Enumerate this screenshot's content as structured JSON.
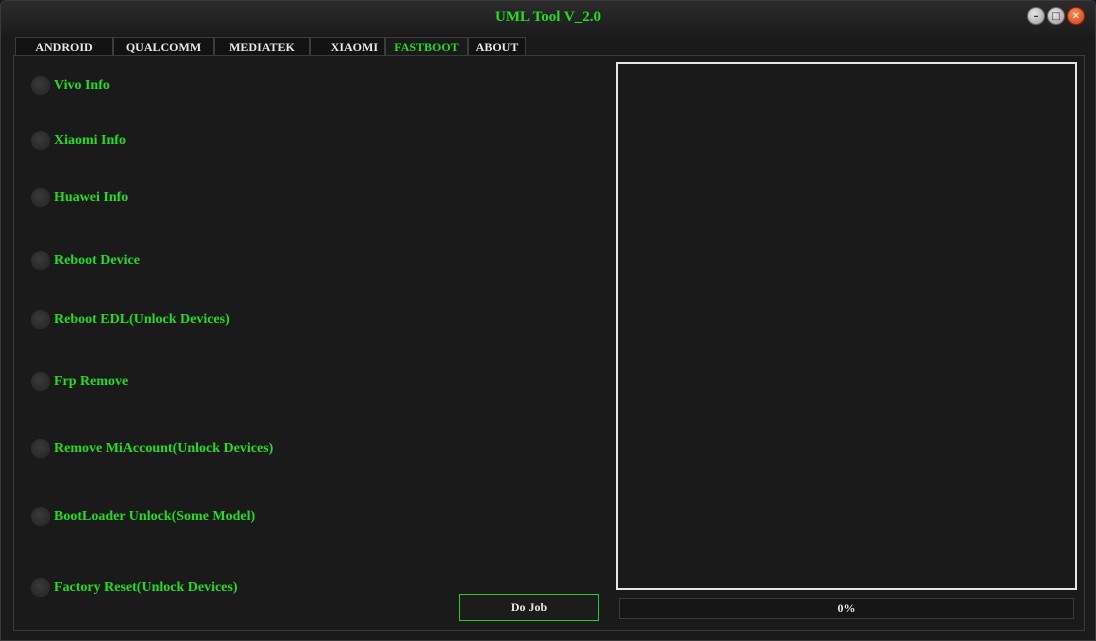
{
  "window": {
    "title": "UML Tool V_2.0"
  },
  "tabs": [
    {
      "label": "ANDROID"
    },
    {
      "label": "QUALCOMM"
    },
    {
      "label": "MEDIATEK"
    },
    {
      "label": "XIAOMI"
    },
    {
      "label": "FASTBOOT",
      "active": true
    },
    {
      "label": "ABOUT"
    }
  ],
  "options": [
    {
      "label": "Vivo Info"
    },
    {
      "label": "Xiaomi Info"
    },
    {
      "label": "Huawei Info"
    },
    {
      "label": "Reboot Device"
    },
    {
      "label": "Reboot EDL(Unlock Devices)"
    },
    {
      "label": "Frp Remove"
    },
    {
      "label": "Remove MiAccount(Unlock Devices)"
    },
    {
      "label": "BootLoader Unlock(Some Model)"
    },
    {
      "label": "Factory Reset(Unlock Devices)"
    }
  ],
  "actions": {
    "do_job_label": "Do Job"
  },
  "progress": {
    "value": 0,
    "text": "0%"
  },
  "colors": {
    "accent": "#22dd22",
    "background": "#1a1a1a",
    "log_border": "#e6e6e6"
  }
}
